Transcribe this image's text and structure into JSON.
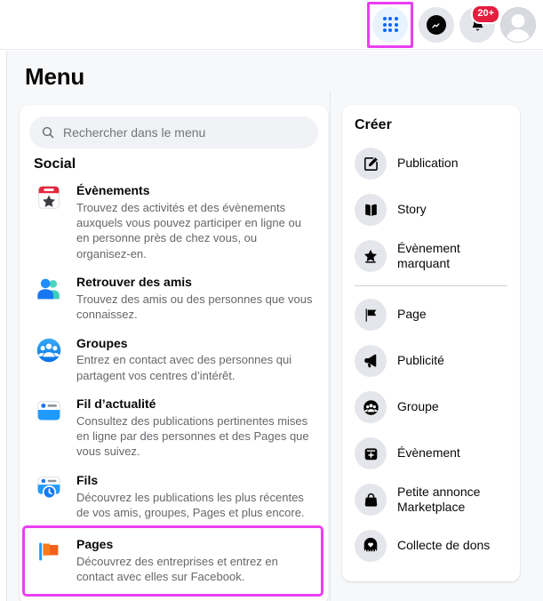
{
  "topbar": {
    "icons": [
      {
        "name": "menu-grid-icon",
        "label": "Menu",
        "highlighted": true
      },
      {
        "name": "messenger-icon",
        "label": "Messenger",
        "highlighted": false
      },
      {
        "name": "notifications-bell-icon",
        "label": "Notifications",
        "badge": "20+",
        "highlighted": false
      },
      {
        "name": "account-avatar",
        "label": "Compte",
        "highlighted": false
      }
    ],
    "notification_badge": "20+"
  },
  "page": {
    "title": "Menu"
  },
  "search": {
    "placeholder": "Rechercher dans le menu",
    "value": "",
    "icon": "search-icon"
  },
  "social": {
    "title": "Social",
    "items": [
      {
        "label": "Évènements",
        "desc": "Trouvez des activités et des évènements auxquels vous pouvez participer en ligne ou en personne près de chez vous, ou organisez-en.",
        "icon": "events-calendar-star-icon",
        "selected": false
      },
      {
        "label": "Retrouver des amis",
        "desc": "Trouvez des amis ou des personnes que vous connaissez.",
        "icon": "find-friends-icon",
        "selected": false
      },
      {
        "label": "Groupes",
        "desc": "Entrez en contact avec des personnes qui partagent vos centres d’intérêt.",
        "icon": "groups-icon",
        "selected": false
      },
      {
        "label": "Fil d’actualité",
        "desc": "Consultez des publications pertinentes mises en ligne par des personnes et des Pages que vous suivez.",
        "icon": "news-feed-icon",
        "selected": false
      },
      {
        "label": "Fils",
        "desc": "Découvrez les publications les plus récentes de vos amis, groupes, Pages et plus encore.",
        "icon": "feeds-clock-icon",
        "selected": false
      },
      {
        "label": "Pages",
        "desc": "Découvrez des entreprises et entrez en contact avec elles sur Facebook.",
        "icon": "pages-flag-icon",
        "selected": true
      }
    ]
  },
  "create": {
    "title": "Créer",
    "group_one": [
      {
        "label": "Publication",
        "icon": "compose-post-icon"
      },
      {
        "label": "Story",
        "icon": "story-book-icon"
      },
      {
        "label": "Évènement marquant",
        "icon": "life-event-star-icon"
      }
    ],
    "group_two": [
      {
        "label": "Page",
        "icon": "page-flag-icon"
      },
      {
        "label": "Publicité",
        "icon": "ad-megaphone-icon"
      },
      {
        "label": "Groupe",
        "icon": "group-people-icon"
      },
      {
        "label": "Évènement",
        "icon": "event-plus-icon"
      },
      {
        "label": "Petite annonce Marketplace",
        "icon": "marketplace-bag-icon"
      },
      {
        "label": "Collecte de dons",
        "icon": "fundraiser-heart-icon"
      }
    ]
  },
  "colors": {
    "highlight": "#ea3ff2",
    "brand_blue": "#0866ff",
    "badge_red": "#e41e3f",
    "page_bg": "#f7f8fa",
    "card_bg": "#ffffff",
    "text_primary": "#080809",
    "text_secondary": "#65676b"
  }
}
